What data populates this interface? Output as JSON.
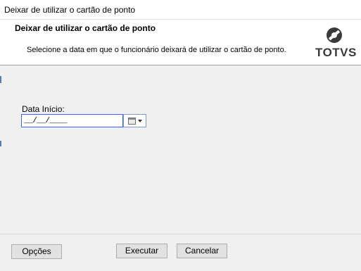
{
  "window": {
    "title": "Deixar de utilizar o cartão de ponto"
  },
  "header": {
    "heading": "Deixar de utilizar o cartão de ponto",
    "subtitle": "Selecione a data em que o funcionário deixará de utilizar o cartão de ponto.",
    "logo_text": "TOTVS"
  },
  "form": {
    "date_label": "Data Início:",
    "date_value": "__/__/____",
    "date_button_icon": "calendar-icon"
  },
  "buttons": {
    "options": "Opções",
    "execute": "Executar",
    "cancel": "Cancelar"
  },
  "colors": {
    "accent": "#3d6fb5",
    "logo": "#3a3a3a"
  }
}
